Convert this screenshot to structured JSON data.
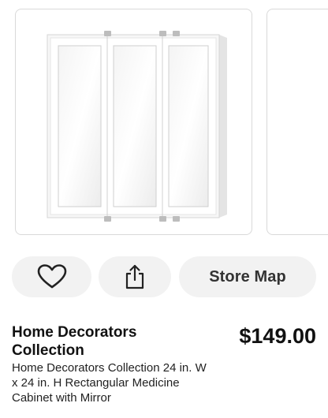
{
  "actions": {
    "favorite_icon": "heart-outline-icon",
    "share_icon": "share-upload-icon",
    "store_map_label": "Store Map"
  },
  "product": {
    "brand": "Home Decorators Collection",
    "price": "$149.00",
    "title": "Home Decorators Collection 24 in. W x 24 in. H Rectangular Medicine Cabinet with Mirror"
  },
  "colors": {
    "button_bg": "#f2f2f2",
    "card_border": "#d9d9d9",
    "text_primary": "#111111"
  }
}
